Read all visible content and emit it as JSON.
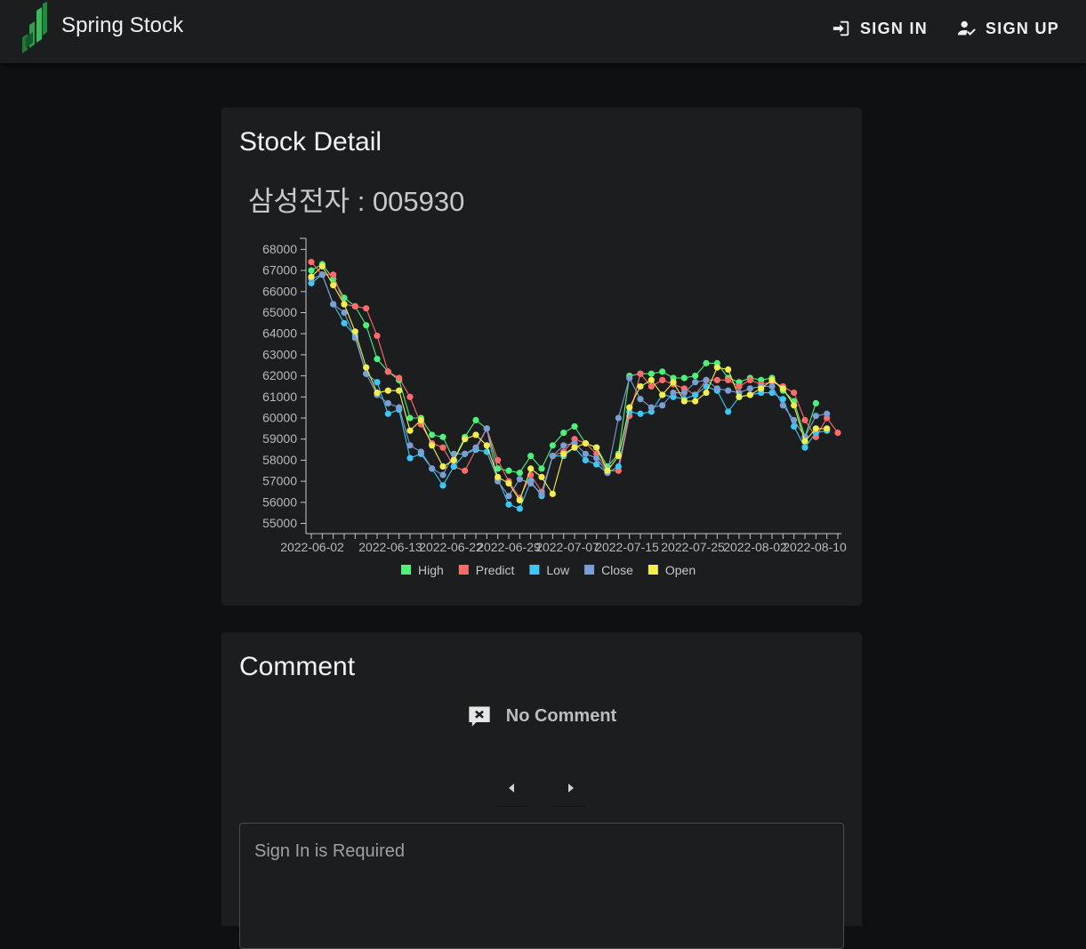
{
  "app": {
    "title": "Spring Stock",
    "sign_in_label": "SIGN IN",
    "sign_up_label": "SIGN UP"
  },
  "detail": {
    "heading": "Stock Detail",
    "stock_label": "삼성전자 : 005930"
  },
  "chart_data": {
    "type": "line",
    "title": "",
    "xlabel": "",
    "ylabel": "",
    "ylim": [
      55000,
      68000
    ],
    "ytick_labels": [
      "55000",
      "56000",
      "57000",
      "58000",
      "59000",
      "60000",
      "61000",
      "62000",
      "63000",
      "64000",
      "65000",
      "66000",
      "67000",
      "68000"
    ],
    "xtick_labels": [
      "2022-06-02",
      "2022-06-13",
      "2022-06-22",
      "2022-06-29",
      "2022-07-07",
      "2022-07-15",
      "2022-07-25",
      "2022-08-02",
      "2022-08-10"
    ],
    "legend_position": "bottom",
    "grid": false,
    "colors": {
      "High": "#4cf27a",
      "Predict": "#ff6b6b",
      "Low": "#3cc8f4",
      "Close": "#7b9fd4",
      "Open": "#f2ef4c"
    },
    "series": [
      {
        "name": "High",
        "values": [
          67000,
          67300,
          66600,
          65700,
          65300,
          64400,
          62800,
          62200,
          61800,
          60000,
          60000,
          59200,
          59100,
          58000,
          59100,
          59900,
          59500,
          57600,
          57500,
          57400,
          58200,
          57600,
          58700,
          59300,
          59600,
          58800,
          58600,
          57700,
          58300,
          62000,
          62100,
          62100,
          62200,
          61900,
          61900,
          62000,
          62600,
          62600,
          61900,
          61700,
          61900,
          61800,
          61900,
          61300,
          60800,
          59100,
          60700
        ]
      },
      {
        "name": "Predict",
        "values": [
          67400,
          66800,
          66800,
          65400,
          65300,
          65200,
          63900,
          62200,
          61900,
          61000,
          59700,
          58800,
          58600,
          57700,
          57500,
          58500,
          59500,
          58000,
          57000,
          56200,
          57300,
          56500,
          58200,
          58400,
          59000,
          58800,
          58300,
          57500,
          57500,
          60100,
          62100,
          61500,
          61800,
          61600,
          61400,
          61100,
          61800,
          61800,
          61800,
          61500,
          61800,
          61600,
          61700,
          61500,
          61200,
          59900,
          59100,
          60000,
          59300
        ]
      },
      {
        "name": "Low",
        "values": [
          66400,
          66800,
          65400,
          64500,
          63900,
          62100,
          61700,
          60200,
          60400,
          58100,
          58300,
          57600,
          56800,
          57700,
          58300,
          58500,
          58400,
          57100,
          55900,
          55700,
          57000,
          56300,
          58200,
          58200,
          58600,
          58000,
          57800,
          57400,
          57700,
          60300,
          60200,
          60300,
          61100,
          61000,
          60900,
          61100,
          61500,
          61300,
          60300,
          61000,
          61100,
          61200,
          61200,
          60900,
          59600,
          58600,
          59300,
          59400
        ]
      },
      {
        "name": "Close",
        "values": [
          66600,
          66800,
          65400,
          65000,
          63800,
          62100,
          61100,
          60700,
          60500,
          58700,
          58400,
          57600,
          57300,
          58300,
          58300,
          58600,
          59500,
          57000,
          56300,
          57100,
          56900,
          56400,
          58200,
          58700,
          58800,
          58300,
          58100,
          57400,
          60000,
          61900,
          60900,
          60500,
          60600,
          61200,
          61200,
          61700,
          61800,
          61400,
          61300,
          61200,
          61400,
          61500,
          61500,
          60600,
          59900,
          59100,
          60100,
          60200
        ]
      },
      {
        "name": "Open",
        "values": [
          66700,
          67200,
          66300,
          65400,
          64100,
          62400,
          61200,
          61300,
          61300,
          59400,
          59900,
          58700,
          57700,
          58000,
          59000,
          59200,
          58700,
          57200,
          56900,
          56100,
          57600,
          57200,
          56400,
          58300,
          58600,
          58800,
          58600,
          57500,
          58200,
          60500,
          61500,
          61800,
          61100,
          61700,
          60800,
          60800,
          61200,
          62400,
          62300,
          61000,
          61100,
          61400,
          61800,
          61400,
          60600,
          58900,
          59500,
          59500
        ]
      }
    ]
  },
  "comments": {
    "heading": "Comment",
    "empty_text": "No Comment",
    "input_placeholder": "Sign In is Required"
  }
}
